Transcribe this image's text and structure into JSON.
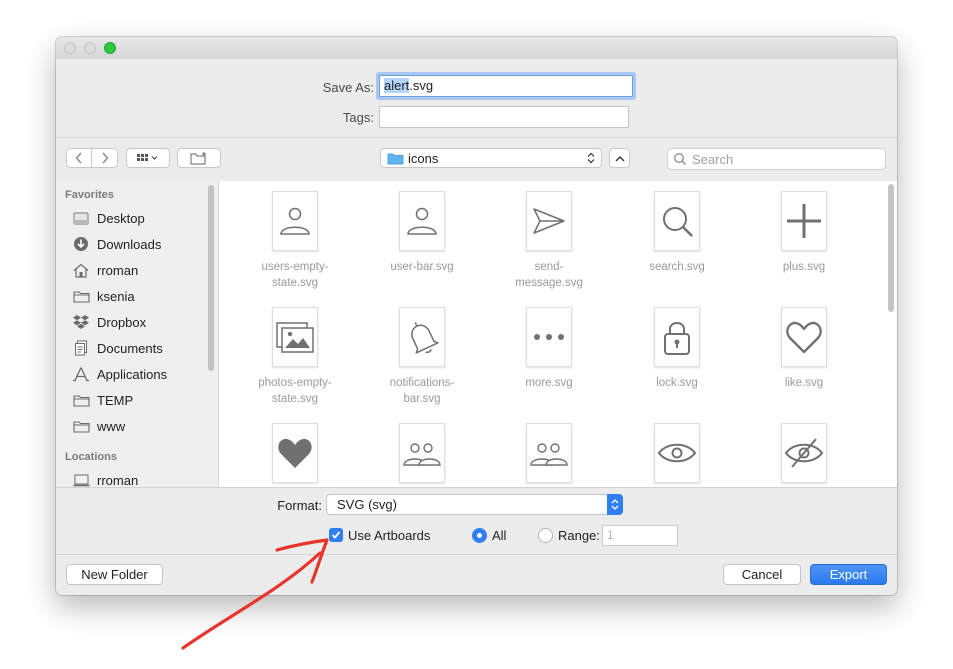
{
  "dialog": {
    "save_as_label": "Save As:",
    "filename_selected": "alert",
    "filename_rest": ".svg",
    "tags_label": "Tags:",
    "tags_value": ""
  },
  "toolbar": {
    "back_icon": "chevron-left-icon",
    "forward_icon": "chevron-right-icon",
    "view_icon": "icon-grid-view",
    "new_folder_icon": "new-folder-icon",
    "location": "icons",
    "search_placeholder": "Search"
  },
  "sidebar": {
    "favorites_title": "Favorites",
    "favorites": [
      {
        "label": "Desktop",
        "icon": "desktop-icon"
      },
      {
        "label": "Downloads",
        "icon": "downloads-icon"
      },
      {
        "label": "rroman",
        "icon": "home-icon"
      },
      {
        "label": "ksenia",
        "icon": "folder-icon"
      },
      {
        "label": "Dropbox",
        "icon": "dropbox-icon"
      },
      {
        "label": "Documents",
        "icon": "documents-icon"
      },
      {
        "label": "Applications",
        "icon": "applications-icon"
      },
      {
        "label": "TEMP",
        "icon": "folder-icon"
      },
      {
        "label": "www",
        "icon": "folder-icon"
      }
    ],
    "locations_title": "Locations",
    "locations": [
      {
        "label": "rroman",
        "icon": "computer-icon"
      }
    ]
  },
  "files": [
    {
      "line1": "users-empty-",
      "line2": "state.svg",
      "icon": "user-icon"
    },
    {
      "line1": "user-bar.svg",
      "line2": "",
      "icon": "user-icon"
    },
    {
      "line1": "send-",
      "line2": "message.svg",
      "icon": "send-icon"
    },
    {
      "line1": "search.svg",
      "line2": "",
      "icon": "search-icon"
    },
    {
      "line1": "plus.svg",
      "line2": "",
      "icon": "plus-icon"
    },
    {
      "line1": "photos-empty-",
      "line2": "state.svg",
      "icon": "photos-icon"
    },
    {
      "line1": "notifications-",
      "line2": "bar.svg",
      "icon": "bell-icon"
    },
    {
      "line1": "more.svg",
      "line2": "",
      "icon": "more-icon"
    },
    {
      "line1": "lock.svg",
      "line2": "",
      "icon": "lock-icon"
    },
    {
      "line1": "like.svg",
      "line2": "",
      "icon": "heart-icon"
    },
    {
      "line1": "",
      "line2": "",
      "icon": "heart-filled-icon"
    },
    {
      "line1": "",
      "line2": "",
      "icon": "users-icon"
    },
    {
      "line1": "",
      "line2": "",
      "icon": "users-icon"
    },
    {
      "line1": "",
      "line2": "",
      "icon": "eye-icon"
    },
    {
      "line1": "",
      "line2": "",
      "icon": "eye-off-icon"
    }
  ],
  "export_options": {
    "format_label": "Format:",
    "format_value": "SVG (svg)",
    "use_artboards_label": "Use Artboards",
    "use_artboards_checked": true,
    "all_label": "All",
    "range_label": "Range:",
    "range_value": "1",
    "selected_scope": "All"
  },
  "buttons": {
    "new_folder": "New Folder",
    "cancel": "Cancel",
    "export": "Export"
  },
  "colors": {
    "accent": "#2f7ff4",
    "annotation_arrow": "#e8342b"
  }
}
